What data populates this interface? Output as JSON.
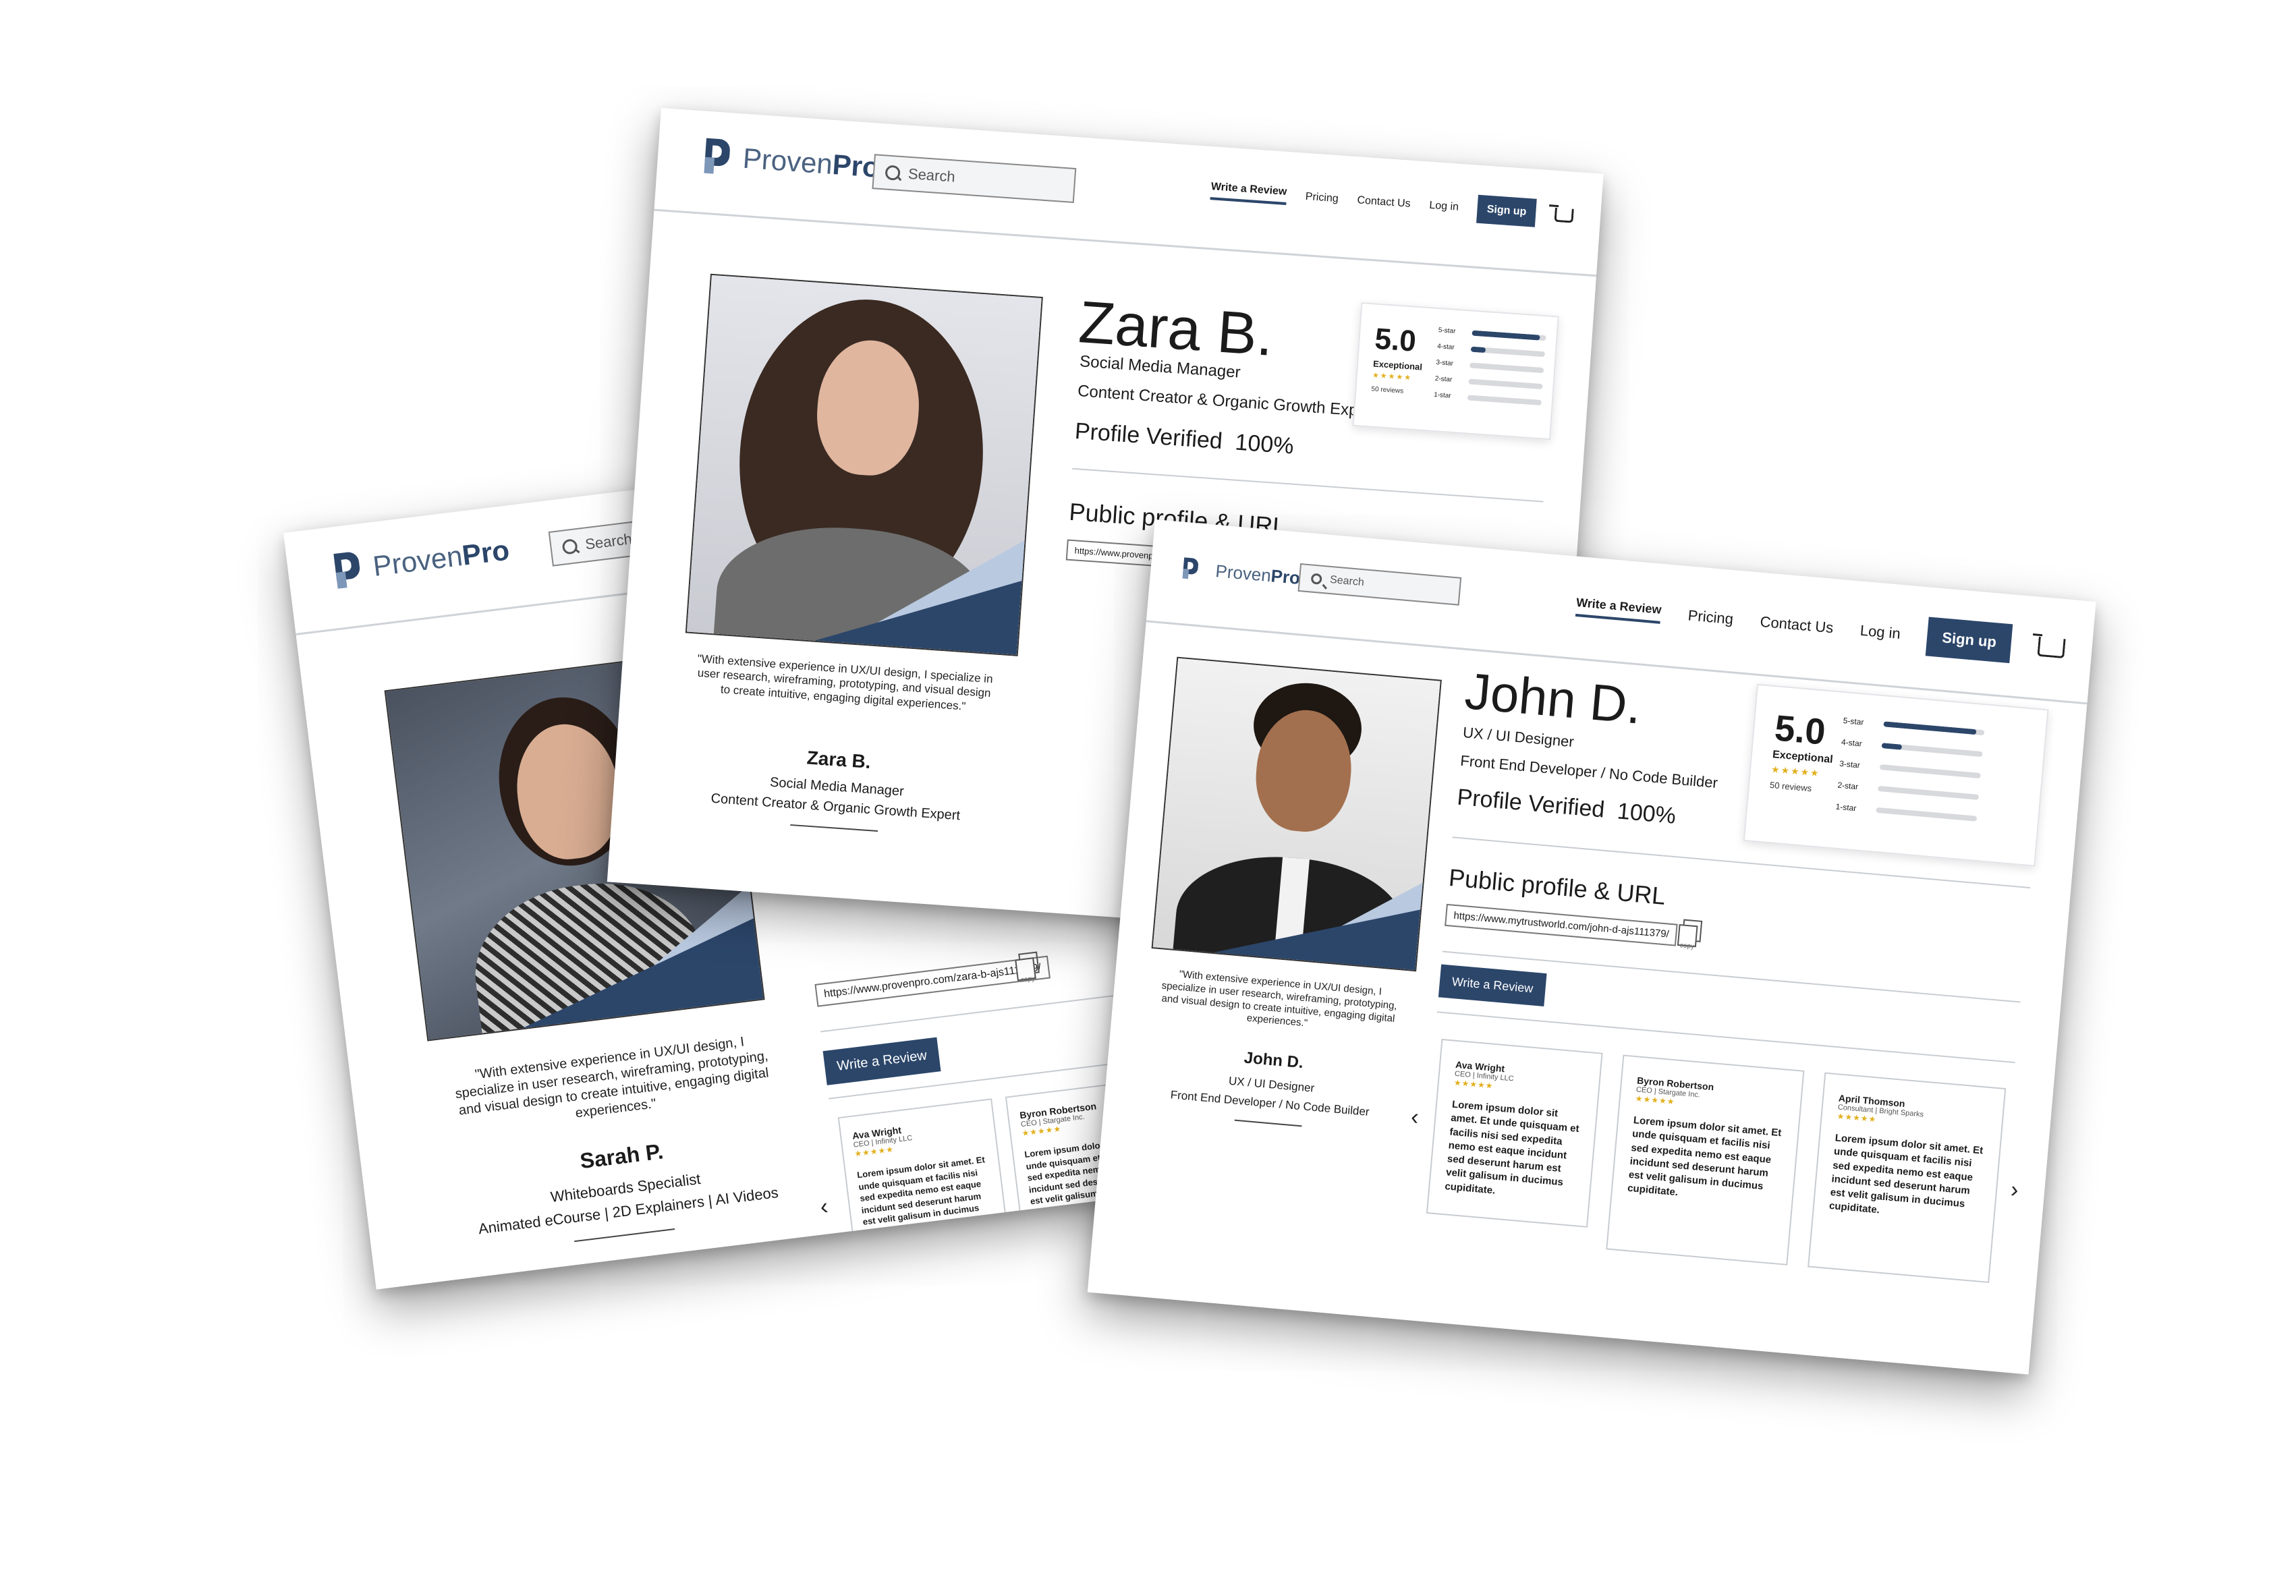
{
  "brand": {
    "name_light": "Proven",
    "name_bold": "Pro"
  },
  "nav": {
    "search_placeholder": "Search",
    "write_review": "Write a Review",
    "pricing": "Pricing",
    "contact": "Contact Us",
    "login": "Log in",
    "signup": "Sign up"
  },
  "rating": {
    "score": "5.0",
    "label": "Exceptional",
    "stars": "★★★★★",
    "count": "50 reviews",
    "rows": [
      {
        "label": "5-star",
        "fill": 0.92
      },
      {
        "label": "4-star",
        "fill": 0.2
      },
      {
        "label": "3-star",
        "fill": 0
      },
      {
        "label": "2-star",
        "fill": 0
      },
      {
        "label": "1-star",
        "fill": 0
      }
    ]
  },
  "common": {
    "verified": "Profile Verified",
    "verified_pct": "100%",
    "public_profile": "Public profile & URL",
    "copy": "copy",
    "write_review_btn": "Write a Review",
    "quote": "\"With extensive experience in UX/UI design, I specialize in user research, wireframing, prototyping, and visual design to create intuitive, engaging digital experiences.\""
  },
  "zara": {
    "name": "Zara B.",
    "role1": "Social Media Manager",
    "role2": "Content Creator & Organic Growth Expert",
    "url": "https://www.provenpro.com/zara-b-ajs111379/"
  },
  "sarah": {
    "name": "Sarah P.",
    "role1": "Whiteboards Specialist",
    "role2": "Animated eCourse | 2D Explainers | AI Videos",
    "url": "https://www.provenpro.com/zara-b-ajs111379/"
  },
  "john": {
    "name": "John D.",
    "role1": "UX / UI Designer",
    "role2": "Front End Developer / No Code Builder",
    "url": "https://www.mytrustworld.com/john-d-ajs111379/"
  },
  "reviews": [
    {
      "name": "Ava Wright",
      "org": "CEO | Infinity LLC",
      "stars": "★★★★★",
      "text": "Lorem ipsum dolor sit amet. Et unde quisquam et facilis nisi sed expedita nemo est eaque incidunt sed deserunt harum est velit galisum in ducimus cupiditate."
    },
    {
      "name": "Byron Robertson",
      "org": "CEO | Stargate Inc.",
      "stars": "★★★★★",
      "text": "Lorem ipsum dolor sit amet. Et unde quisquam et facilis nisi sed expedita nemo est eaque incidunt sed deserunt harum est velit galisum in ducimus cupiditate."
    },
    {
      "name": "April Thomson",
      "org": "Consultant | Bright Sparks",
      "stars": "★★★★★",
      "text": "Lorem ipsum dolor sit amet. Et unde quisquam et facilis nisi sed expedita nemo est eaque incidunt sed deserunt harum est velit galisum in ducimus cupiditate."
    }
  ]
}
